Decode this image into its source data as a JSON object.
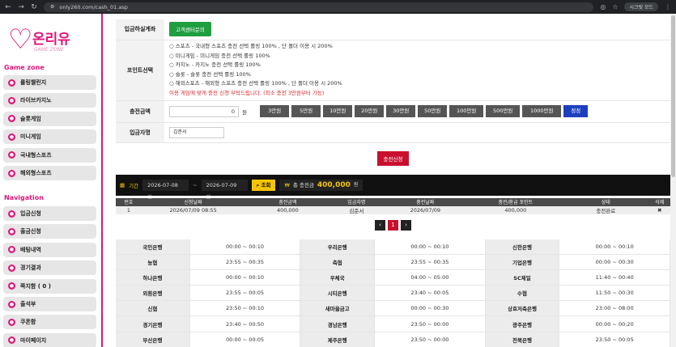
{
  "browser": {
    "url": "only260.com/cash_01.asp",
    "profile_label": "시크릿 모드"
  },
  "sidebar": {
    "logo_text": "온리유",
    "logo_sub": "GAME ZONE",
    "game_zone_title": "Game zone",
    "game_items": [
      {
        "label": "롤링챌린지",
        "icon": "trophy-icon"
      },
      {
        "label": "라이브카지노",
        "icon": "cards-icon"
      },
      {
        "label": "슬롯게임",
        "icon": "slot-icon"
      },
      {
        "label": "미니게임",
        "icon": "gamepad-icon"
      },
      {
        "label": "국내형스포츠",
        "icon": "soccer-ball-icon"
      },
      {
        "label": "해외형스포츠",
        "icon": "basketball-icon"
      }
    ],
    "navigation_title": "Navigation",
    "nav_items": [
      {
        "label": "입금신청",
        "icon": "deposit-icon"
      },
      {
        "label": "출금신청",
        "icon": "withdraw-icon"
      },
      {
        "label": "배팅내역",
        "icon": "list-icon"
      },
      {
        "label": "경기결과",
        "icon": "result-icon"
      },
      {
        "label": "쪽지함 ( 0 )",
        "icon": "message-icon"
      },
      {
        "label": "출석부",
        "icon": "calendar-icon"
      },
      {
        "label": "쿠폰함",
        "icon": "coupon-icon"
      },
      {
        "label": "마이페이지",
        "icon": "user-icon"
      }
    ]
  },
  "form": {
    "account_label": "입금하실계좌",
    "account_button": "고객센터문의",
    "point_label": "포인트선택",
    "options": [
      "○ 스포츠 - 국내형 스포츠 충전 선택 롤링 100% , 단 폴더 이용 시 200%",
      "○ 미니게임 - 미니게임 충전 선택 롤링 100%",
      "○ 카지노 - 카지노 충전 선택 롤링 100%",
      "○ 슬롯 - 슬롯 충전 선택 롤링 100%",
      "○ 해외스포츠 - 해외형 스포츠 충전 선택 롤링 100% , 단 폴더 이용 시 200%"
    ],
    "warning": "이용 게임에 맞게 충전 신청 부탁드립니다. (최소 충전 3만원부터 가능)",
    "amount_label": "충전금액",
    "amount_value": "0",
    "won": "원",
    "amount_buttons": [
      "3만원",
      "5만원",
      "10만원",
      "20만원",
      "30만원",
      "50만원",
      "100만원",
      "500만원",
      "1000만원"
    ],
    "reset_button": "정정",
    "depositor_label": "입금자명",
    "depositor_value": "김준서",
    "submit_button": "충전신청"
  },
  "filter": {
    "period_label": "기간",
    "date_from": "2026-07-08",
    "tilde": "~",
    "date_to": "2026-07-09",
    "search_button": "조회",
    "total_label": "총 충전금",
    "total_value": "400,000",
    "total_unit": "원"
  },
  "history": {
    "headers": [
      "번호",
      "신청날짜",
      "충전금액",
      "입금자명",
      "충전날짜",
      "충전/환급 포인트",
      "상태",
      "삭제"
    ],
    "rows": [
      [
        "1",
        "2026/07/09 08:55",
        "400,000",
        "김준서",
        "2026/07/09",
        "400,000",
        "충전완료",
        "✖"
      ]
    ]
  },
  "pager": {
    "prev": "‹",
    "current": "1",
    "next": "›"
  },
  "banks": [
    [
      [
        "국민은행",
        "00:00 ~ 00:10"
      ],
      [
        "우리은행",
        "00:00 ~ 00:10"
      ],
      [
        "신한은행",
        "00:00 ~ 00:10"
      ]
    ],
    [
      [
        "농협",
        "23:55 ~ 00:35"
      ],
      [
        "축협",
        "23:55 ~ 00:35"
      ],
      [
        "기업은행",
        "00:00 ~ 00:30"
      ]
    ],
    [
      [
        "하나은행",
        "00:00 ~ 00:10"
      ],
      [
        "우체국",
        "04:00 ~ 05:00"
      ],
      [
        "SC제일",
        "11:40 ~ 00:40"
      ]
    ],
    [
      [
        "외환은행",
        "23:55 ~ 00:05"
      ],
      [
        "시티은행",
        "23:40 ~ 00:05"
      ],
      [
        "수협",
        "11:50 ~ 00:30"
      ]
    ],
    [
      [
        "신협",
        "23:50 ~ 00:10"
      ],
      [
        "새마을금고",
        "00:00 ~ 00:30"
      ],
      [
        "상호저축은행",
        "23:00 ~ 08:00"
      ]
    ],
    [
      [
        "경기은행",
        "23:40 ~ 00:50"
      ],
      [
        "경남은행",
        "23:50 ~ 00:00"
      ],
      [
        "광주은행",
        "00:00 ~ 00:20"
      ]
    ],
    [
      [
        "부산은행",
        "00:00 ~ 00:05"
      ],
      [
        "제주은행",
        "23:50 ~ 00:00"
      ],
      [
        "전북은행",
        "23:50 ~ 00:05"
      ]
    ]
  ]
}
